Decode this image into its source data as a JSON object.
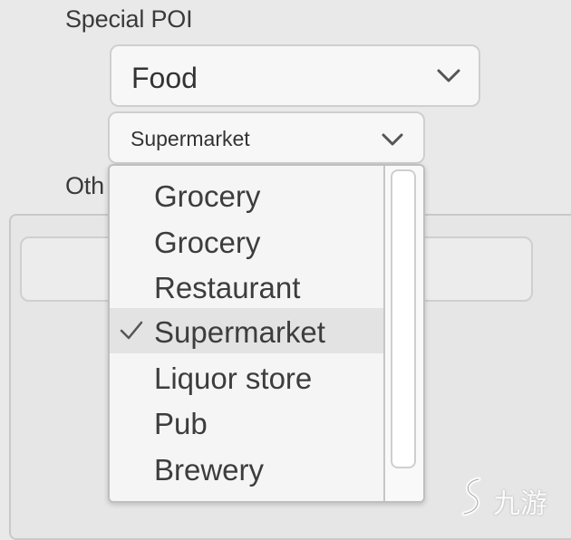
{
  "special_poi": {
    "label": "Special POI",
    "category": {
      "value": "Food",
      "icon": "chevron-down-icon"
    },
    "subcategory": {
      "value": "Supermarket",
      "icon": "chevron-down-icon"
    }
  },
  "other": {
    "label": "Oth"
  },
  "dropdown": {
    "options": [
      {
        "label": "Grocery",
        "selected": false
      },
      {
        "label": "Grocery",
        "selected": false
      },
      {
        "label": "Restaurant",
        "selected": false
      },
      {
        "label": "Supermarket",
        "selected": true
      },
      {
        "label": "Liquor store",
        "selected": false
      },
      {
        "label": "Pub",
        "selected": false
      },
      {
        "label": "Brewery",
        "selected": false
      }
    ],
    "check_icon": "check-icon"
  },
  "watermark": {
    "text": "九游"
  }
}
